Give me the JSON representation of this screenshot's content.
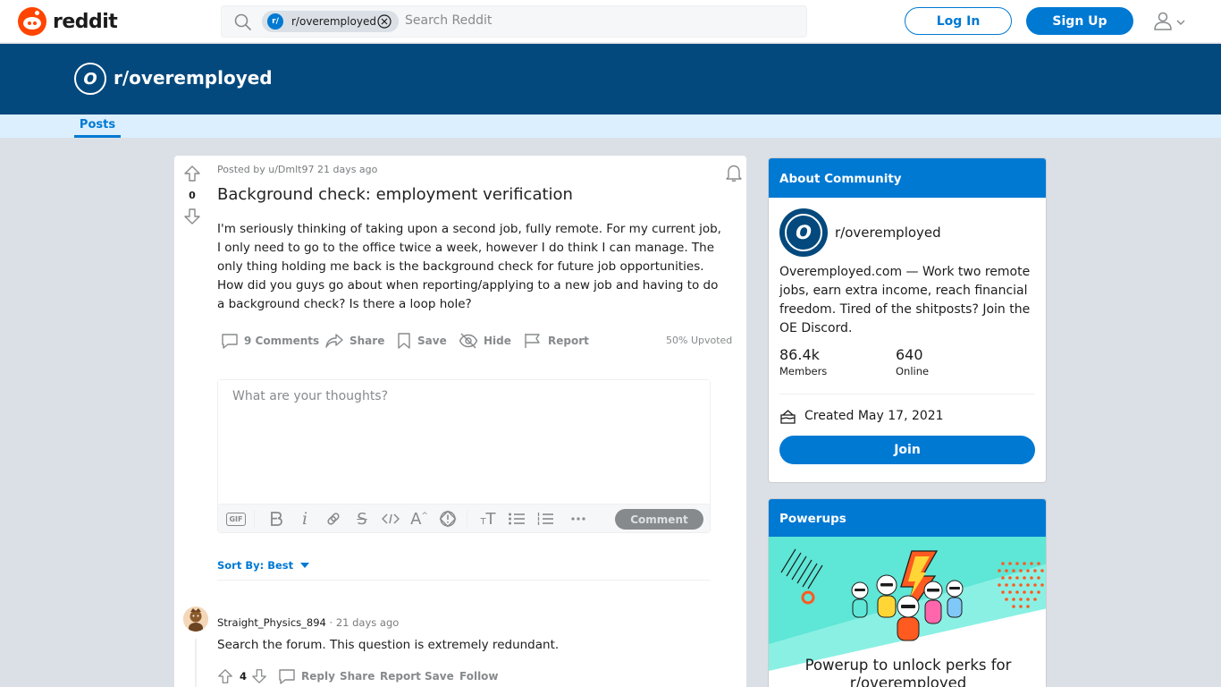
{
  "header": {
    "logo_text": "reddit",
    "search_chip_label": "r/overemployed",
    "search_chip_avatar": "r/",
    "search_placeholder": "Search Reddit",
    "login_label": "Log In",
    "signup_label": "Sign Up"
  },
  "banner": {
    "avatar_letter": "O",
    "title": "r/overemployed"
  },
  "tabs": {
    "posts_label": "Posts"
  },
  "post": {
    "vote_count": "0",
    "meta": "Posted by u/Dmlt97 21 days ago",
    "title": "Background check: employment verification",
    "body": "I'm seriously thinking of taking upon a second job, fully remote. For my current job, I only need to go to the office twice a week, however I do think I can manage. The only thing holding me back is the background check for future job opportunities. How did you guys go about when reporting/applying to a new job and having to do a background check? Is there a loop hole?",
    "actions": {
      "comments": "9 Comments",
      "share": "Share",
      "save": "Save",
      "hide": "Hide",
      "report": "Report"
    },
    "upvoted": "50% Upvoted"
  },
  "editor": {
    "placeholder": "What are your thoughts?",
    "comment_button": "Comment",
    "gif_label": "GIF"
  },
  "sort": {
    "label": "Sort By: Best"
  },
  "comments": [
    {
      "author": "Straight_Physics_894",
      "separator": "·",
      "time": "21 days ago",
      "text": "Search the forum. This question is extremely redundant.",
      "votes": "4",
      "reply": "Reply",
      "share": "Share",
      "report": "Report",
      "save": "Save",
      "follow": "Follow"
    }
  ],
  "about": {
    "header": "About Community",
    "avatar_letter": "O",
    "name": "r/overemployed",
    "description": "Overemployed.com — Work two remote jobs, earn extra income, reach financial freedom. Tired of the shitposts? Join the OE Discord.",
    "members_count": "86.4k",
    "members_label": "Members",
    "online_count": "640",
    "online_label": "Online",
    "created": "Created May 17, 2021",
    "join_label": "Join"
  },
  "powerups": {
    "header": "Powerups",
    "text": "Powerup to unlock perks for r/overemployed"
  },
  "colors": {
    "accent": "#0079d3",
    "banner": "#03497d",
    "brand": "#ff4500"
  }
}
